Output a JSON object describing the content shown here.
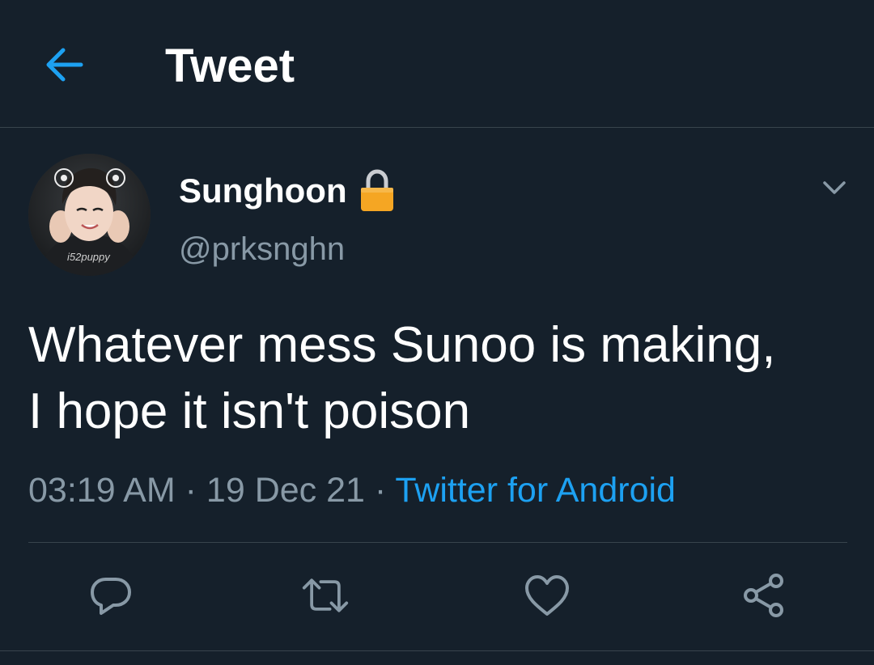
{
  "header": {
    "back_icon": "arrow-left-icon",
    "title": "Tweet"
  },
  "tweet": {
    "author": {
      "display_name": "Sunghoon",
      "handle": "@prksnghn",
      "protected_icon": "lock-icon",
      "avatar_text": "i52puppy"
    },
    "text": "Whatever mess Sunoo is making,\nI hope it isn't poison",
    "time": "03:19 AM",
    "date": "19 Dec 21",
    "separator": "·",
    "source": "Twitter for Android"
  },
  "actions": [
    {
      "name": "reply",
      "icon": "reply-icon"
    },
    {
      "name": "retweet",
      "icon": "retweet-icon"
    },
    {
      "name": "like",
      "icon": "heart-icon"
    },
    {
      "name": "share",
      "icon": "share-icon"
    }
  ],
  "colors": {
    "background": "#15202b",
    "accent": "#1da1f2",
    "secondary_text": "#8899a6",
    "divider": "#38444d",
    "lock": "#f5a623"
  }
}
